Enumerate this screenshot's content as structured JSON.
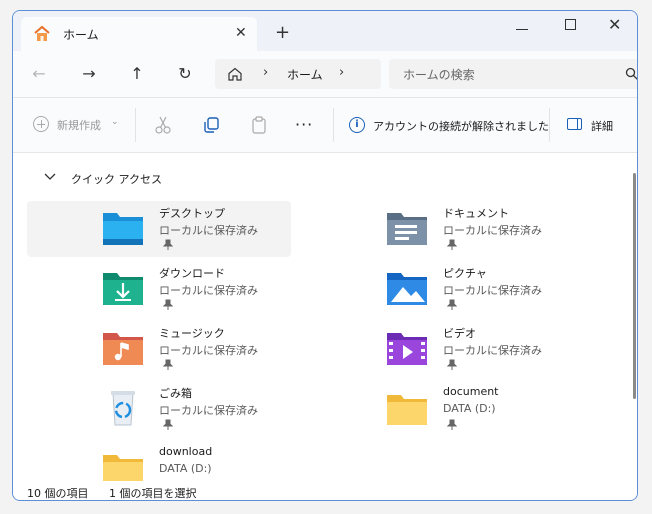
{
  "tab": {
    "title": "ホーム",
    "close_glyph": "✕",
    "new_tab_glyph": "+"
  },
  "window_controls": {
    "close_glyph": "✕"
  },
  "nav": {
    "back_glyph": "←",
    "forward_glyph": "→",
    "up_glyph": "↑",
    "refresh_glyph": "↻",
    "address_sep": "›",
    "address_text": "ホーム",
    "search_placeholder": "ホームの検索"
  },
  "toolbar": {
    "new_label": "新規作成",
    "new_chevron": "⌄",
    "more_glyph": "···",
    "info_label": "アカウントの接続が解除されました",
    "details_label": "詳細"
  },
  "quick_access": {
    "title": "クイック アクセス",
    "items": [
      {
        "name": "デスクトップ",
        "sub": "ローカルに保存済み",
        "pinned": true,
        "icon": "desktop-folder-icon"
      },
      {
        "name": "ドキュメント",
        "sub": "ローカルに保存済み",
        "pinned": true,
        "icon": "documents-folder-icon"
      },
      {
        "name": "ダウンロード",
        "sub": "ローカルに保存済み",
        "pinned": true,
        "icon": "downloads-folder-icon"
      },
      {
        "name": "ピクチャ",
        "sub": "ローカルに保存済み",
        "pinned": true,
        "icon": "pictures-folder-icon"
      },
      {
        "name": "ミュージック",
        "sub": "ローカルに保存済み",
        "pinned": true,
        "icon": "music-folder-icon"
      },
      {
        "name": "ビデオ",
        "sub": "ローカルに保存済み",
        "pinned": true,
        "icon": "videos-folder-icon"
      },
      {
        "name": "ごみ箱",
        "sub": "ローカルに保存済み",
        "pinned": true,
        "icon": "recycle-bin-icon"
      },
      {
        "name": "document",
        "sub": "DATA (D:)",
        "pinned": true,
        "icon": "folder-icon"
      },
      {
        "name": "download",
        "sub": "DATA (D:)",
        "pinned": false,
        "icon": "folder-icon"
      }
    ]
  },
  "status": {
    "count": "10 個の項目",
    "selected": "1 個の項目を選択"
  },
  "colors": {
    "accent": "#1b5fb9",
    "window_border": "#5b8fd6",
    "selected_bg": "#f3f3f3"
  }
}
